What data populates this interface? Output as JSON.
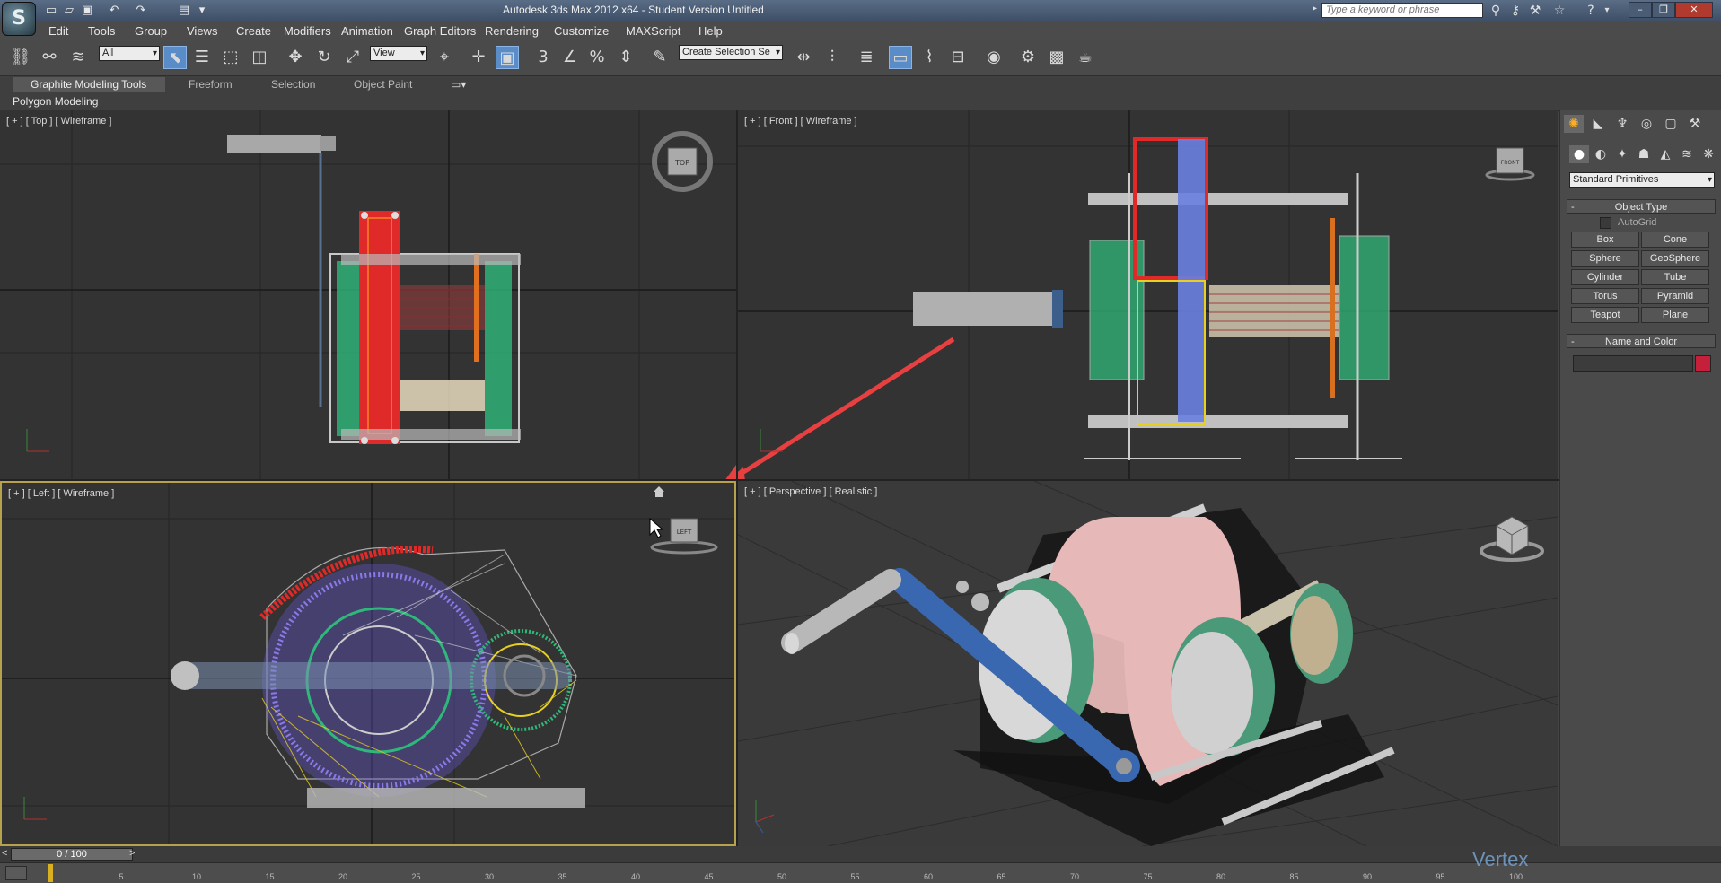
{
  "title_bar": {
    "title": "Autodesk 3ds Max  2012 x64   -  Student Version    Untitled",
    "search_placeholder": "Type a keyword or phrase",
    "logo_icon": "3dsmax-logo-icon"
  },
  "menu": [
    "Edit",
    "Tools",
    "Group",
    "Views",
    "Create",
    "Modifiers",
    "Animation",
    "Graph Editors",
    "Rendering",
    "Customize",
    "MAXScript",
    "Help"
  ],
  "toolbar": {
    "selection_filter": "All",
    "reference_coord": "View",
    "named_selection": "Create Selection Se",
    "snap_labels": {
      "snap3": "3",
      "percent": "%"
    }
  },
  "ribbon": {
    "tabs": [
      "Graphite Modeling Tools",
      "Freeform",
      "Selection",
      "Object Paint"
    ],
    "active_tab": "Graphite Modeling Tools",
    "panel": "Polygon Modeling"
  },
  "viewports": {
    "top": {
      "label": "[ + ] [ Top ] [ Wireframe ]",
      "cube_label": "TOP"
    },
    "front": {
      "label": "[ + ] [ Front ] [ Wireframe ]",
      "cube_label": "FRONT"
    },
    "left": {
      "label": "[ + ] [ Left ] [ Wireframe ]",
      "cube_label": "LEFT"
    },
    "perspective": {
      "label": "[ + ] [ Perspective ] [ Realistic ]"
    }
  },
  "command_panel": {
    "category_dropdown": "Standard Primitives",
    "object_type_title": "Object Type",
    "autogrid_label": "AutoGrid",
    "autogrid_checked": false,
    "buttons": [
      "Box",
      "Cone",
      "Sphere",
      "GeoSphere",
      "Cylinder",
      "Tube",
      "Torus",
      "Pyramid",
      "Teapot",
      "Plane"
    ],
    "name_color_title": "Name and Color",
    "object_color": "#c4203c"
  },
  "timeline": {
    "frame_display": "0 / 100",
    "ticks": [
      "5",
      "10",
      "15",
      "20",
      "25",
      "30",
      "35",
      "40",
      "45",
      "50",
      "55",
      "60",
      "65",
      "70",
      "75",
      "80",
      "85",
      "90",
      "95",
      "100"
    ]
  },
  "watermark": "Vertex",
  "colors": {
    "active_viewport_border": "#b7a24c",
    "annotation_arrow": "#e84040",
    "selection_accent": "#5a8cc8"
  }
}
